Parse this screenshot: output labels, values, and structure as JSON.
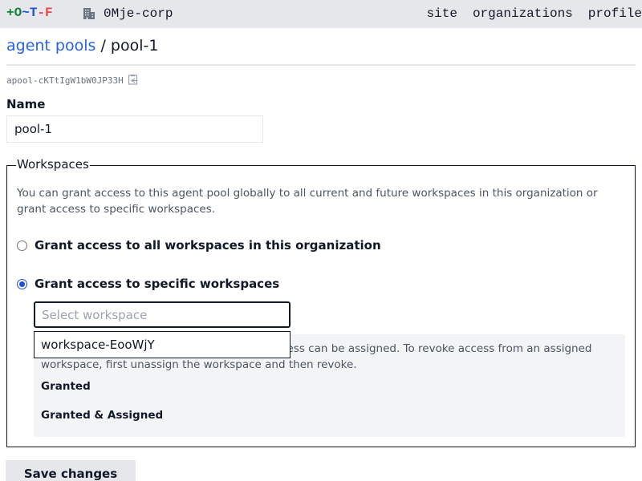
{
  "topbar": {
    "logo": {
      "plus": "+",
      "o": "O",
      "tilde": "~",
      "t": "T",
      "dash": "-",
      "f": "F"
    },
    "organization": "0Mje-corp",
    "organization_icon": "building-icon",
    "nav": [
      "site",
      "organizations",
      "profile"
    ]
  },
  "breadcrumb": {
    "parent": "agent pools",
    "separator": " / ",
    "current": "pool-1"
  },
  "identifier": {
    "value": "apool-cKTtIgW1bW0JP33H",
    "icon": "clipboard-copy-icon"
  },
  "form": {
    "name_label": "Name",
    "name_value": "pool-1",
    "workspaces": {
      "legend": "Workspaces",
      "description": "You can grant access to this agent pool globally to all current and future workspaces in this organization or grant access to specific workspaces.",
      "options": [
        {
          "label": "Grant access to all workspaces in this organization",
          "checked": false
        },
        {
          "label": "Grant access to specific workspaces",
          "checked": true
        }
      ],
      "select_placeholder": "Select workspace",
      "dropdown_options": [
        "workspace-EooWjY"
      ],
      "info_text": "Only workspaces that have been granted access can be assigned. To revoke access from an assigned workspace, first unassign the workspace and then revoke.",
      "granted_heading": "Granted",
      "granted_assigned_heading": "Granted & Assigned"
    },
    "save_label": "Save changes"
  },
  "colors": {
    "link": "#2563eb",
    "logo_green": "#15803d",
    "logo_blue": "#1d4ed8",
    "logo_red": "#ef4444",
    "topbar_bg": "#e5e7eb"
  }
}
